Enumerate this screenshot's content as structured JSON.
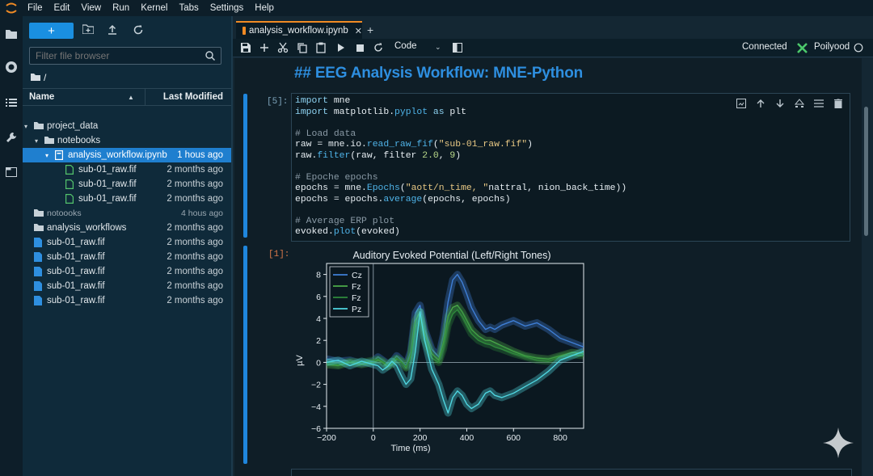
{
  "menubar": {
    "items": [
      "File",
      "Edit",
      "View",
      "Run",
      "Kernel",
      "Tabs",
      "Settings",
      "Help"
    ]
  },
  "activity_bar": {
    "icons": [
      "folder-icon",
      "running-icon",
      "toc-icon",
      "wrench-icon",
      "tabs-icon"
    ]
  },
  "file_browser": {
    "new_button": "+",
    "filter_placeholder": "Filter file browser",
    "breadcrumb": "/",
    "columns": {
      "name": "Name",
      "modified": "Last Modified"
    },
    "rows": [
      {
        "name": "project_data",
        "modified": "",
        "kind": "folder",
        "depth": 0,
        "chevron": "▾"
      },
      {
        "name": "notebooks",
        "modified": "",
        "kind": "folder",
        "depth": 1,
        "chevron": "▾"
      },
      {
        "name": "analysis_workflow.ipynb",
        "modified": "1 hous ago",
        "kind": "notebook",
        "depth": 2,
        "selected": true,
        "chevron": "▾"
      },
      {
        "name": "sub-01_raw.fif",
        "modified": "2 months ago",
        "kind": "file-green",
        "depth": 3
      },
      {
        "name": "sub-01_raw.fif",
        "modified": "2 months ago",
        "kind": "file-green",
        "depth": 3
      },
      {
        "name": "sub-01_raw.fif",
        "modified": "2 months ago",
        "kind": "file-green",
        "depth": 3
      },
      {
        "name": "notoooks",
        "modified": "4 hous ago",
        "kind": "folder",
        "depth": 0,
        "dim": true
      },
      {
        "name": "analysis_workflows",
        "modified": "2 months ago",
        "kind": "folder",
        "depth": 0
      },
      {
        "name": "sub-01_raw.fif",
        "modified": "2 months ago",
        "kind": "file-blue",
        "depth": 0
      },
      {
        "name": "sub-01_raw.fif",
        "modified": "2 months ago",
        "kind": "file-blue",
        "depth": 0
      },
      {
        "name": "sub-01_raw.fif",
        "modified": "2 months ago",
        "kind": "file-blue",
        "depth": 0
      },
      {
        "name": "sub-01_raw.fif",
        "modified": "2 months ago",
        "kind": "file-blue",
        "depth": 0
      },
      {
        "name": "sub-01_raw.fif",
        "modified": "2 months ago",
        "kind": "file-blue",
        "depth": 0
      }
    ]
  },
  "notebook": {
    "tab_label": "analysis_workflow.ipynb",
    "toolbar": {
      "cell_type": "Code",
      "kernel_status": "Connected",
      "kernel_name": "Poilyood"
    },
    "markdown_heading": "## EEG Analysis Workflow: MNE-Python",
    "code_cell": {
      "prompt": "[5]:",
      "lines": [
        "import mne",
        "import matplotlib.pyplot as plt",
        "",
        "# Load data",
        "raw = mne.io.read_raw_fif(\"sub-01_raw.fif\")",
        "raw.filter(raw, filter 2.0, 9)",
        "",
        "# Epoche epochs",
        "epochs = mne.Epochs(\"aott/n_time, \"nattral, nion_back_time))",
        "epochs = epochs.average(epochs, epochs)",
        "",
        "# Average ERP plot",
        "evoked.plot(evoked)"
      ]
    },
    "output_prompt": "[1]:"
  },
  "chart_data": {
    "type": "line",
    "title": "Auditory Evoked Potential (Left/Right Tones)",
    "xlabel": "Time (ms)",
    "ylabel": "µV",
    "xlim": [
      -200,
      900
    ],
    "ylim": [
      -6,
      9
    ],
    "xticks": [
      "−200",
      "0",
      "200",
      "400",
      "600",
      "800"
    ],
    "yticks": [
      "−6",
      "−4",
      "−2",
      "0",
      "2",
      "4",
      "6",
      "8"
    ],
    "grid": false,
    "legend_position": "top-left",
    "series": [
      {
        "name": "Cz",
        "color": "#3f7fd6",
        "x": [
          -200,
          -150,
          -100,
          -50,
          0,
          20,
          40,
          60,
          80,
          100,
          120,
          140,
          160,
          180,
          200,
          220,
          250,
          280,
          300,
          320,
          340,
          360,
          380,
          400,
          420,
          450,
          480,
          500,
          520,
          550,
          600,
          650,
          700,
          750,
          800,
          850,
          900
        ],
        "y": [
          0.3,
          0.1,
          0.2,
          -0.1,
          0.1,
          0.5,
          0.2,
          -0.1,
          0.0,
          0.6,
          0.2,
          -0.3,
          1.0,
          4.5,
          5.2,
          3.0,
          1.2,
          0.5,
          2.5,
          5.5,
          7.5,
          8.0,
          7.3,
          6.2,
          5.0,
          3.8,
          3.0,
          3.2,
          3.0,
          3.4,
          3.8,
          3.3,
          3.6,
          3.0,
          2.2,
          1.8,
          1.4
        ]
      },
      {
        "name": "Fz",
        "color": "#4caa4a",
        "x": [
          -200,
          -150,
          -100,
          -50,
          0,
          20,
          40,
          60,
          80,
          100,
          120,
          140,
          160,
          180,
          200,
          220,
          250,
          280,
          300,
          320,
          340,
          360,
          380,
          400,
          420,
          450,
          480,
          500,
          520,
          550,
          600,
          650,
          700,
          750,
          800,
          850,
          900
        ],
        "y": [
          -0.2,
          -0.3,
          0.0,
          -0.2,
          0.0,
          0.2,
          0.0,
          -0.4,
          -0.2,
          0.3,
          0.1,
          -0.5,
          0.6,
          3.8,
          4.6,
          2.6,
          0.8,
          0.2,
          1.8,
          4.2,
          5.0,
          5.2,
          4.6,
          3.8,
          3.0,
          2.4,
          2.0,
          2.0,
          1.8,
          1.5,
          1.0,
          0.6,
          0.4,
          0.3,
          0.6,
          0.9,
          0.8
        ]
      },
      {
        "name": "Fz",
        "color": "#2f8a3c",
        "x": [
          -200,
          -150,
          -100,
          -50,
          0,
          20,
          40,
          60,
          80,
          100,
          120,
          140,
          160,
          180,
          200,
          220,
          250,
          280,
          300,
          320,
          340,
          360,
          380,
          400,
          420,
          450,
          480,
          500,
          520,
          550,
          600,
          650,
          700,
          750,
          800,
          850,
          900
        ],
        "y": [
          0.0,
          -0.2,
          0.1,
          0.0,
          0.2,
          0.3,
          0.1,
          -0.2,
          0.1,
          0.4,
          0.0,
          -0.4,
          0.4,
          3.2,
          4.0,
          2.0,
          0.4,
          0.0,
          1.2,
          3.4,
          4.4,
          4.8,
          4.2,
          3.4,
          2.6,
          2.0,
          1.7,
          1.6,
          1.4,
          1.2,
          0.8,
          0.5,
          0.2,
          0.1,
          0.5,
          0.7,
          0.6
        ]
      },
      {
        "name": "Pz",
        "color": "#4fd6e0",
        "x": [
          -200,
          -150,
          -100,
          -50,
          0,
          20,
          40,
          60,
          80,
          100,
          120,
          140,
          160,
          180,
          200,
          220,
          250,
          280,
          300,
          320,
          340,
          360,
          380,
          400,
          420,
          450,
          480,
          500,
          520,
          550,
          600,
          650,
          700,
          750,
          800,
          850,
          900
        ],
        "y": [
          0.0,
          0.2,
          -0.3,
          0.1,
          -0.2,
          -0.3,
          -0.7,
          -0.4,
          0.1,
          -0.3,
          -1.2,
          -2.0,
          -1.5,
          1.0,
          4.6,
          2.0,
          -0.6,
          -2.0,
          -3.4,
          -4.6,
          -3.2,
          -2.6,
          -3.0,
          -3.8,
          -4.2,
          -3.8,
          -2.8,
          -2.6,
          -3.0,
          -3.2,
          -2.8,
          -2.2,
          -1.6,
          -0.8,
          0.2,
          0.6,
          1.0
        ]
      }
    ]
  }
}
